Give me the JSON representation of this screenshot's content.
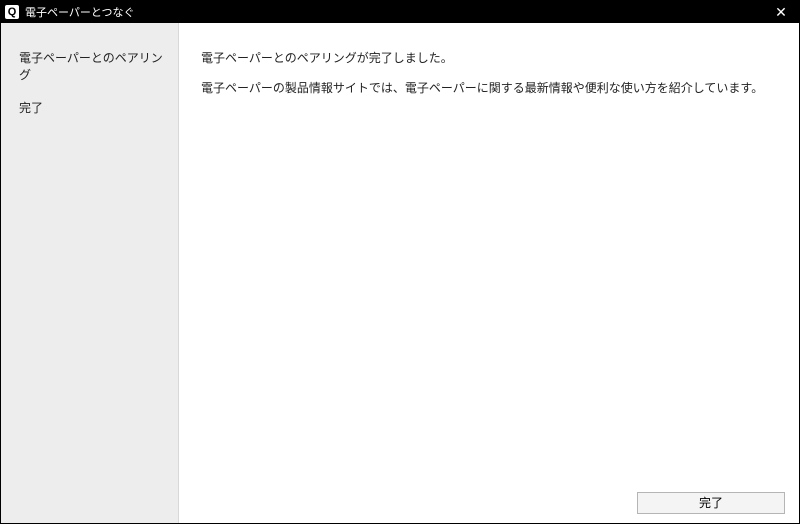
{
  "titlebar": {
    "icon_letter": "Q",
    "title": "電子ペーパーとつなぐ",
    "close_glyph": "✕"
  },
  "sidebar": {
    "items": [
      {
        "label": "電子ペーパーとのペアリング"
      },
      {
        "label": "完了"
      }
    ]
  },
  "content": {
    "line1": "電子ペーパーとのペアリングが完了しました。",
    "line2": "電子ペーパーの製品情報サイトでは、電子ペーパーに関する最新情報や便利な使い方を紹介しています。"
  },
  "footer": {
    "finish_label": "完了"
  }
}
